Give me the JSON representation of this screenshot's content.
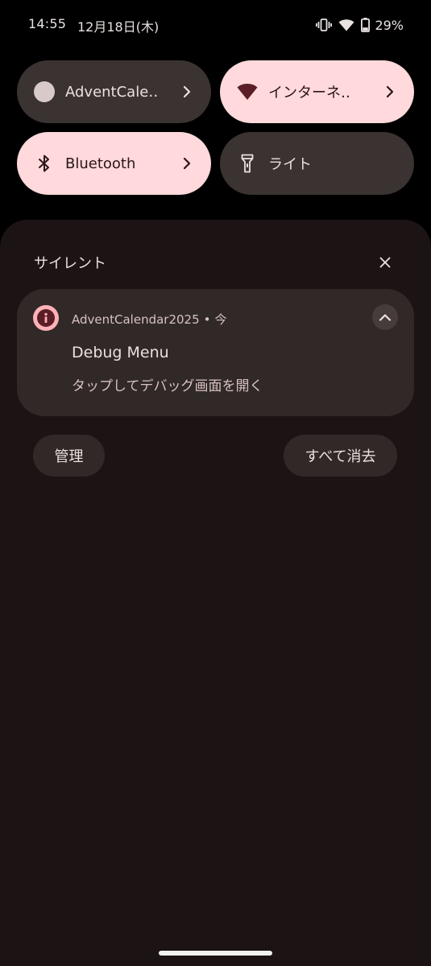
{
  "status_bar": {
    "time": "14:55",
    "date": "12月18日(木)",
    "icons": [
      "vibrate-icon",
      "wifi-icon",
      "battery-icon"
    ],
    "battery_percent": "29%"
  },
  "quick_settings": {
    "tiles": [
      {
        "label": "AdventCale‥",
        "icon": "app-circle-icon",
        "state": "off",
        "has_chevron": true
      },
      {
        "label": "インターネ‥",
        "icon": "wifi-icon",
        "state": "on",
        "has_chevron": true
      },
      {
        "label": "Bluetooth",
        "icon": "bluetooth-icon",
        "state": "on",
        "has_chevron": true
      },
      {
        "label": "ライト",
        "icon": "flashlight-icon",
        "state": "off",
        "has_chevron": false
      }
    ]
  },
  "notifications": {
    "section_title": "サイレント",
    "close_icon": "close-icon",
    "items": [
      {
        "app_icon": "info-icon",
        "app_name": "AdventCalendar2025",
        "separator": "•",
        "time": "今",
        "title": "Debug Menu",
        "text": "タップしてデバッグ画面を開く",
        "expand_icon": "chevron-up-icon"
      }
    ],
    "manage_label": "管理",
    "clear_all_label": "すべて消去"
  },
  "colors": {
    "background": "#000000",
    "shade": "#1c1414",
    "card": "#302928",
    "tile_off": "#3a3332",
    "tile_on": "#ffd9db",
    "accent": "#ffb1b8"
  }
}
